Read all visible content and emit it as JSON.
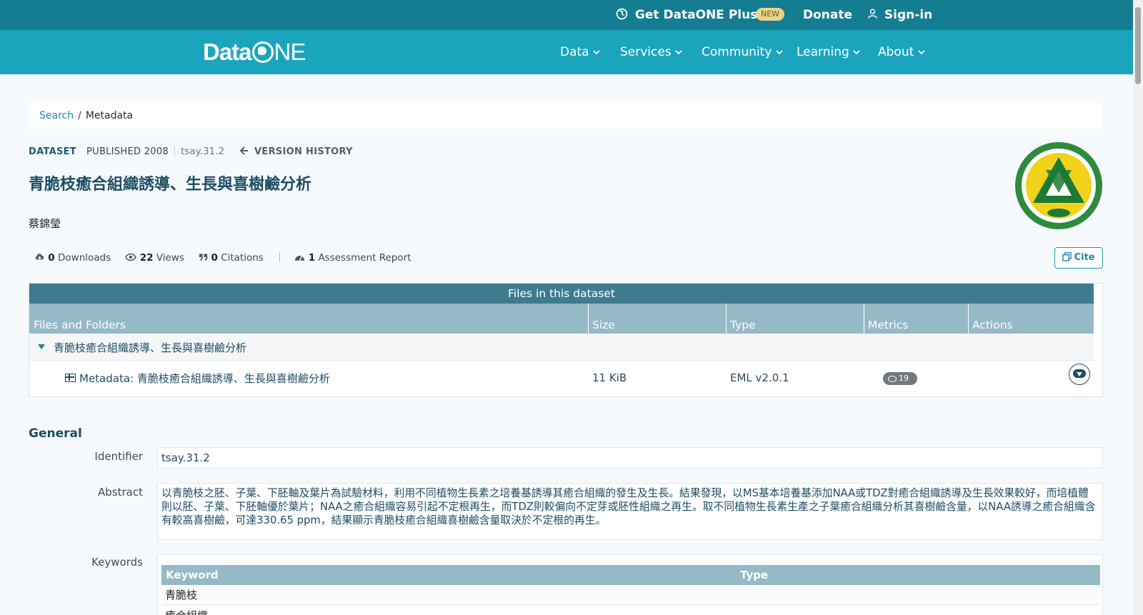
{
  "topbar": {
    "plus_label": "Get DataONE Plus",
    "new_badge": "NEW",
    "donate_label": "Donate",
    "signin_label": "Sign-in"
  },
  "navbar": {
    "logo_prefix": "Data",
    "logo_suffix": "NE",
    "items": [
      "Data",
      "Services",
      "Community",
      "Learning",
      "About"
    ]
  },
  "breadcrumb": {
    "search": "Search",
    "separator": "/",
    "current": "Metadata"
  },
  "dataset": {
    "type_label": "DATASET",
    "published": "PUBLISHED 2008",
    "pid": "tsay.31.2",
    "version_history": "VERSION HISTORY",
    "title": "青脆枝癒合組織誘導、生長與喜樹鹼分析",
    "author": "蔡錦瑩"
  },
  "stats": {
    "downloads_count": "0",
    "downloads_label": "Downloads",
    "views_count": "22",
    "views_label": "Views",
    "citations_count": "0",
    "citations_label": "Citations",
    "assessment_count": "1",
    "assessment_label": "Assessment Report"
  },
  "cite_label": "Cite",
  "files_table": {
    "caption": "Files in this dataset",
    "columns": [
      "Files and Folders",
      "Size",
      "Type",
      "Metrics",
      "Actions"
    ],
    "folder": "青脆枝癒合組織誘導、生長與喜樹鹼分析",
    "file": {
      "name": "Metadata: 青脆枝癒合組織誘導、生長與喜樹鹼分析",
      "size": "11 KiB",
      "type": "EML v2.0.1",
      "views": "19"
    }
  },
  "general": {
    "heading": "General",
    "identifier_label": "Identifier",
    "identifier": "tsay.31.2",
    "abstract_label": "Abstract",
    "abstract": "以青脆枝之胚、子葉、下胚軸及葉片為試驗材料，利用不同植物生長素之培養基誘導其癒合組織的發生及生長。結果發現，以MS基本培養基添加NAA或TDZ對癒合組織誘導及生長效果較好，而培植體則以胚、子葉、下胚軸優於葉片；NAA之癒合組織容易引起不定根再生，而TDZ則較偏向不定芽或胚性組織之再生。取不同植物生長素生產之子葉癒合組織分析其喜樹鹼含量，以NAA誘導之癒合組織含有較高喜樹鹼，可達330.65 ppm，結果顯示青脆枝癒合組織喜樹鹼含量取決於不定根的再生。",
    "keywords_label": "Keywords",
    "keyword_col": "Keyword",
    "type_col": "Type",
    "keywords": [
      "青脆枝",
      "癒合組織"
    ]
  },
  "colors": {
    "topbar": "#147d92",
    "navbar": "#1ba5bd",
    "accent": "#1b8aa5",
    "title": "#1c4d63",
    "table_header": "#96b9c6",
    "table_caption": "#3f7b8f"
  },
  "icons": [
    "globe-icon",
    "chevron-down-icon",
    "user-icon",
    "cloud-download-icon",
    "eye-icon",
    "quote-icon",
    "gauge-icon",
    "arrow-left-icon",
    "copy-icon",
    "caret-down-icon",
    "table-icon"
  ]
}
